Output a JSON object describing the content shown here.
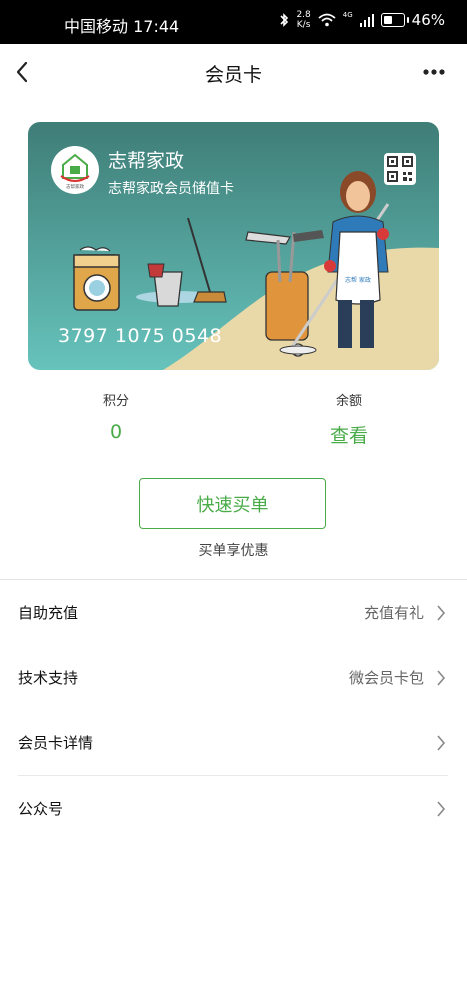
{
  "status_bar": {
    "carrier_time": "中国移动 17:44",
    "speed_value": "2.8",
    "speed_unit": "K/s",
    "network": "4G",
    "battery": "46%",
    "battery_level": 0.46
  },
  "nav": {
    "title": "会员卡"
  },
  "card": {
    "name": "志帮家政",
    "subtitle": "志帮家政会员储值卡",
    "number": "3797 1075 0548",
    "logo_text": "志帮家政",
    "apron_text": "志帮 家政",
    "colors": {
      "top": "#3f7d77",
      "bottom": "#66c3bc",
      "sand": "#ead9a8"
    }
  },
  "stats": {
    "points_label": "积分",
    "points_value": "0",
    "balance_label": "余额",
    "balance_value": "查看"
  },
  "buy": {
    "button": "快速买单",
    "tip": "买单享优惠"
  },
  "menu": [
    {
      "label": "自助充值",
      "value": "充值有礼"
    },
    {
      "label": "技术支持",
      "value": "微会员卡包"
    },
    {
      "label": "会员卡详情",
      "value": ""
    },
    {
      "label": "公众号",
      "value": ""
    }
  ],
  "accent": "#4aab49"
}
